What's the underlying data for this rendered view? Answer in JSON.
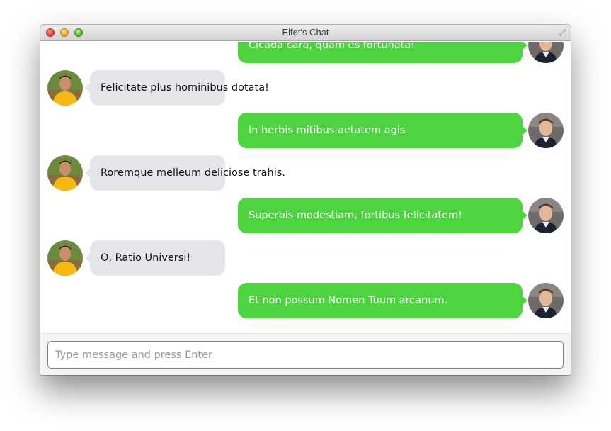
{
  "window": {
    "title": "Elfet's Chat"
  },
  "colors": {
    "outgoing_bubble": "#4cd53e",
    "incoming_bubble": "#e5e5ea",
    "input_border": "#3e8fd5"
  },
  "messages": [
    {
      "direction": "outgoing",
      "text": "Cicada cara, quam es fortunata!",
      "avatar": "user-avatar-dark-shirt"
    },
    {
      "direction": "incoming",
      "text": "Felicitate plus hominibus dotata!",
      "avatar": "contact-avatar-yellow-shirt"
    },
    {
      "direction": "outgoing",
      "text": "In herbis mitibus aetatem agis",
      "avatar": "user-avatar-dark-shirt"
    },
    {
      "direction": "incoming",
      "text": "Roremque melleum deliciose trahis.",
      "avatar": "contact-avatar-yellow-shirt"
    },
    {
      "direction": "outgoing",
      "text": "Superbis modestiam, fortibus felicitatem!",
      "avatar": "user-avatar-dark-shirt"
    },
    {
      "direction": "incoming",
      "text": "O, Ratio Universi!",
      "avatar": "contact-avatar-yellow-shirt"
    },
    {
      "direction": "outgoing",
      "text": "Et non possum Nomen Tuum arcanum.",
      "avatar": "user-avatar-dark-shirt"
    }
  ],
  "composer": {
    "placeholder": "Type message and press Enter",
    "value": ""
  }
}
